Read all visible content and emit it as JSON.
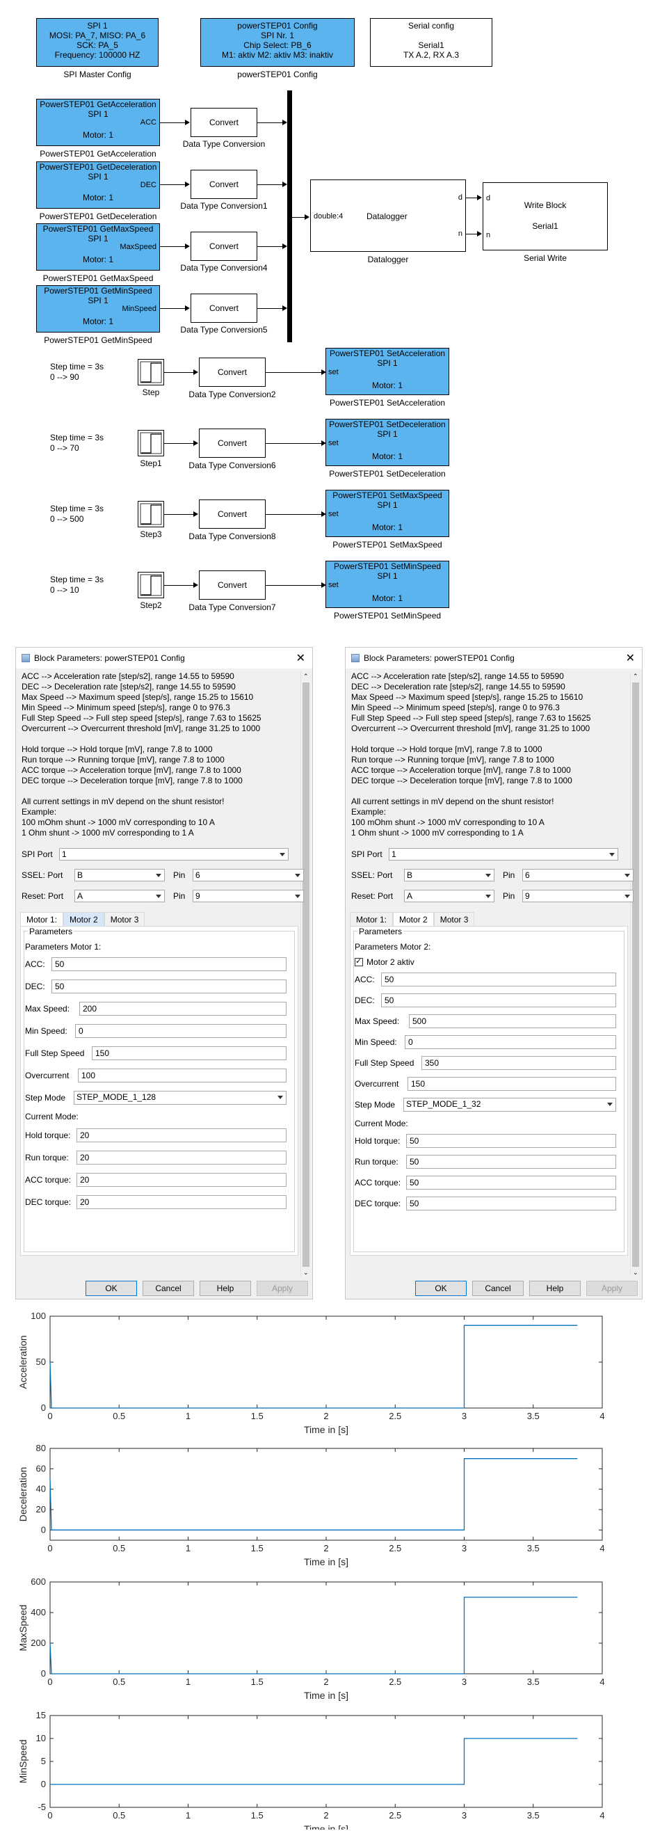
{
  "diagram": {
    "config_blocks": [
      {
        "lines": [
          "SPI 1",
          "MOSI: PA_7, MISO: PA_6",
          "SCK: PA_5",
          "Frequency: 100000 HZ"
        ],
        "caption": "SPI Master Config"
      },
      {
        "lines": [
          "powerSTEP01 Config",
          "SPI Nr. 1",
          "Chip Select: PB_6",
          "M1: aktiv M2: aktiv M3: inaktiv"
        ],
        "caption": "powerSTEP01 Config"
      },
      {
        "lines": [
          "Serial config",
          "",
          "Serial1",
          "TX A.2, RX A.3"
        ],
        "caption": ""
      }
    ],
    "get_blocks": [
      {
        "title": "PowerSTEP01 GetAcceleration",
        "spi": "SPI 1",
        "motor": "Motor: 1",
        "port": "ACC",
        "caption": "PowerSTEP01 GetAcceleration",
        "convert": "Convert",
        "conv_caption": "Data Type Conversion"
      },
      {
        "title": "PowerSTEP01 GetDeceleration",
        "spi": "SPI 1",
        "motor": "Motor: 1",
        "port": "DEC",
        "caption": "PowerSTEP01 GetDeceleration",
        "convert": "Convert",
        "conv_caption": "Data Type Conversion1"
      },
      {
        "title": "PowerSTEP01 GetMaxSpeed",
        "spi": "SPI 1",
        "motor": "Motor: 1",
        "port": "MaxSpeed",
        "caption": "PowerSTEP01 GetMaxSpeed",
        "convert": "Convert",
        "conv_caption": "Data Type Conversion4"
      },
      {
        "title": "PowerSTEP01 GetMinSpeed",
        "spi": "SPI 1",
        "motor": "Motor: 1",
        "port": "MinSpeed",
        "caption": "PowerSTEP01 GetMinSpeed",
        "convert": "Convert",
        "conv_caption": "Data Type Conversion5"
      }
    ],
    "datalogger": {
      "in_port": "double:4",
      "title": "Datalogger",
      "out_d": "d",
      "out_n": "n",
      "caption": "Datalogger"
    },
    "write_block": {
      "in_d": "d",
      "in_n": "n",
      "title": "Write Block",
      "subtitle": "Serial1",
      "caption": "Serial Write"
    },
    "set_rows": [
      {
        "note1": "Step time = 3s",
        "note2": "0 --> 90",
        "step_caption": "Step",
        "convert": "Convert",
        "conv_caption": "Data Type Conversion2",
        "title": "PowerSTEP01 SetAcceleration",
        "spi": "SPI 1",
        "port": "set",
        "motor": "Motor: 1",
        "caption": "PowerSTEP01 SetAcceleration"
      },
      {
        "note1": "Step time = 3s",
        "note2": "0 --> 70",
        "step_caption": "Step1",
        "convert": "Convert",
        "conv_caption": "Data Type Conversion6",
        "title": "PowerSTEP01 SetDeceleration",
        "spi": "SPI 1",
        "port": "set",
        "motor": "Motor: 1",
        "caption": "PowerSTEP01 SetDeceleration"
      },
      {
        "note1": "Step time = 3s",
        "note2": "0 --> 500",
        "step_caption": "Step3",
        "convert": "Convert",
        "conv_caption": "Data Type Conversion8",
        "title": "PowerSTEP01 SetMaxSpeed",
        "spi": "SPI 1",
        "port": "set",
        "motor": "Motor: 1",
        "caption": "PowerSTEP01 SetMaxSpeed"
      },
      {
        "note1": "Step time = 3s",
        "note2": "0 --> 10",
        "step_caption": "Step2",
        "convert": "Convert",
        "conv_caption": "Data Type Conversion7",
        "title": "PowerSTEP01 SetMinSpeed",
        "spi": "SPI 1",
        "port": "set",
        "motor": "Motor: 1",
        "caption": "PowerSTEP01 SetMinSpeed"
      }
    ]
  },
  "dialogs": [
    {
      "title": "Block Parameters: powerSTEP01 Config",
      "description": [
        "ACC --> Acceleration rate [step/s2], range 14.55 to 59590",
        "DEC --> Deceleration rate [step/s2], range 14.55 to 59590",
        "Max Speed --> Maximum speed [step/s], range 15.25 to 15610",
        "Min Speed --> Minimum speed [step/s], range 0 to 976.3",
        "Full Step Speed --> Full step speed [step/s], range 7.63 to 15625",
        "Overcurrent --> Overcurrent threshold [mV], range 31.25 to 1000",
        "",
        "Hold torque --> Hold torque [mV], range 7.8 to 1000",
        "Run torque --> Running torque [mV], range 7.8 to 1000",
        "ACC torque --> Acceleration torque [mV], range 7.8 to 1000",
        "DEC torque --> Deceleration torque [mV], range 7.8 to 1000",
        "",
        "All current settings in mV depend on the shunt resistor!",
        "Example:",
        "100 mOhm shunt -> 1000 mV corresponding to 10 A",
        "1 Ohm shunt -> 1000 mV corresponding to 1 A"
      ],
      "spi_port_label": "SPI Port",
      "spi_port": "1",
      "ssel_label": "SSEL: Port",
      "ssel_port": "B",
      "ssel_pin_label": "Pin",
      "ssel_pin": "6",
      "reset_label": "Reset: Port",
      "reset_port": "A",
      "reset_pin_label": "Pin",
      "reset_pin": "9",
      "tabs": [
        "Motor 1:",
        "Motor 2",
        "Motor 3"
      ],
      "active_tab": 0,
      "group_label": "Parameters",
      "section_label": "Parameters Motor 1:",
      "checkbox_label": "",
      "acc_label": "ACC:",
      "acc": "50",
      "dec_label": "DEC:",
      "dec": "50",
      "max_speed_label": "Max Speed:",
      "max_speed": "200",
      "min_speed_label": "Min Speed:",
      "min_speed": "0",
      "full_step_label": "Full Step Speed",
      "full_step": "150",
      "overcurrent_label": "Overcurrent",
      "overcurrent": "100",
      "step_mode_label": "Step Mode",
      "step_mode": "STEP_MODE_1_128",
      "current_mode_label": "Current Mode:",
      "hold_label": "Hold torque:",
      "hold": "20",
      "run_label": "Run torque:",
      "run": "20",
      "acc_torque_label": "ACC torque:",
      "acc_torque": "20",
      "dec_torque_label": "DEC torque:",
      "dec_torque": "20",
      "buttons": {
        "ok": "OK",
        "cancel": "Cancel",
        "help": "Help",
        "apply": "Apply"
      }
    },
    {
      "title": "Block Parameters: powerSTEP01 Config",
      "description": [
        "ACC --> Acceleration rate [step/s2], range 14.55 to 59590",
        "DEC --> Deceleration rate [step/s2], range 14.55 to 59590",
        "Max Speed --> Maximum speed [step/s], range 15.25 to 15610",
        "Min Speed --> Minimum speed [step/s], range 0 to 976.3",
        "Full Step Speed --> Full step speed [step/s], range 7.63 to 15625",
        "Overcurrent --> Overcurrent threshold [mV], range 31.25 to 1000",
        "",
        "Hold torque --> Hold torque [mV], range 7.8 to 1000",
        "Run torque --> Running torque [mV], range 7.8 to 1000",
        "ACC torque --> Acceleration torque [mV], range 7.8 to 1000",
        "DEC torque --> Deceleration torque [mV], range 7.8 to 1000",
        "",
        "All current settings in mV depend on the shunt resistor!",
        "Example:",
        "100 mOhm shunt -> 1000 mV corresponding to 10 A",
        "1 Ohm shunt -> 1000 mV corresponding to 1 A"
      ],
      "spi_port_label": "SPI Port",
      "spi_port": "1",
      "ssel_label": "SSEL: Port",
      "ssel_port": "B",
      "ssel_pin_label": "Pin",
      "ssel_pin": "6",
      "reset_label": "Reset: Port",
      "reset_port": "A",
      "reset_pin_label": "Pin",
      "reset_pin": "9",
      "tabs": [
        "Motor 1:",
        "Motor 2",
        "Motor 3"
      ],
      "active_tab": 1,
      "group_label": "Parameters",
      "section_label": "Parameters Motor 2:",
      "checkbox_label": "Motor 2 aktiv",
      "acc_label": "ACC:",
      "acc": "50",
      "dec_label": "DEC:",
      "dec": "50",
      "max_speed_label": "Max Speed:",
      "max_speed": "500",
      "min_speed_label": "Min Speed:",
      "min_speed": "0",
      "full_step_label": "Full Step Speed",
      "full_step": "350",
      "overcurrent_label": "Overcurrent",
      "overcurrent": "150",
      "step_mode_label": "Step Mode",
      "step_mode": "STEP_MODE_1_32",
      "current_mode_label": "Current Mode:",
      "hold_label": "Hold torque:",
      "hold": "50",
      "run_label": "Run torque:",
      "run": "50",
      "acc_torque_label": "ACC torque:",
      "acc_torque": "50",
      "dec_torque_label": "DEC torque:",
      "dec_torque": "50",
      "buttons": {
        "ok": "OK",
        "cancel": "Cancel",
        "help": "Help",
        "apply": "Apply"
      }
    }
  ],
  "colors": {
    "block_blue": "#5bb4ee",
    "line_blue": "#0072bd"
  },
  "chart_data": [
    {
      "type": "line",
      "ylabel": "Acceleration",
      "xlabel": "Time in [s]",
      "xlim": [
        0,
        4
      ],
      "ylim": [
        0,
        100
      ],
      "xticks": [
        "0",
        "0.5",
        "1",
        "1.5",
        "2",
        "2.5",
        "3",
        "3.5",
        "4"
      ],
      "yticks": [
        "0",
        "50",
        "100"
      ],
      "series": [
        {
          "x": [
            0,
            0.01,
            0.02,
            3.0,
            3.0,
            3.82
          ],
          "y": [
            50,
            0,
            0,
            0,
            90,
            90
          ]
        }
      ]
    },
    {
      "type": "line",
      "ylabel": "Deceleration",
      "xlabel": "Time in [s]",
      "xlim": [
        0,
        4
      ],
      "ylim": [
        -10,
        80
      ],
      "xticks": [
        "0",
        "0.5",
        "1",
        "1.5",
        "2",
        "2.5",
        "3",
        "3.5",
        "4"
      ],
      "yticks": [
        "0",
        "20",
        "40",
        "60",
        "80"
      ],
      "series": [
        {
          "x": [
            0,
            0.01,
            0.02,
            3.0,
            3.0,
            3.82
          ],
          "y": [
            50,
            0,
            0,
            0,
            70,
            70
          ]
        }
      ]
    },
    {
      "type": "line",
      "ylabel": "MaxSpeed",
      "xlabel": "Time in [s]",
      "xlim": [
        0,
        4
      ],
      "ylim": [
        0,
        600
      ],
      "xticks": [
        "0",
        "0.5",
        "1",
        "1.5",
        "2",
        "2.5",
        "3",
        "3.5",
        "4"
      ],
      "yticks": [
        "0",
        "200",
        "400",
        "600"
      ],
      "series": [
        {
          "x": [
            0,
            0.01,
            0.02,
            3.0,
            3.0,
            3.82
          ],
          "y": [
            200,
            0,
            0,
            0,
            500,
            500
          ]
        }
      ]
    },
    {
      "type": "line",
      "ylabel": "MinSpeed",
      "xlabel": "Time in [s]",
      "xlim": [
        0,
        4
      ],
      "ylim": [
        -5,
        15
      ],
      "xticks": [
        "0",
        "0.5",
        "1",
        "1.5",
        "2",
        "2.5",
        "3",
        "3.5",
        "4"
      ],
      "yticks": [
        "-5",
        "0",
        "5",
        "10",
        "15"
      ],
      "series": [
        {
          "x": [
            0,
            3.0,
            3.0,
            3.82
          ],
          "y": [
            0,
            0,
            10,
            10
          ]
        }
      ]
    }
  ]
}
